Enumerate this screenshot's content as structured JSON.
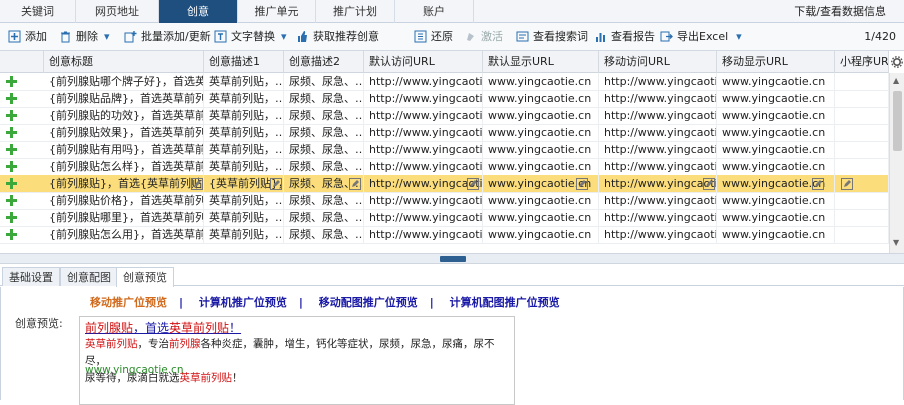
{
  "tabs": [
    "关键词",
    "网页地址",
    "创意",
    "推广单元",
    "推广计划",
    "账户"
  ],
  "tabbar_right": "下载/查看数据信息",
  "toolbar": {
    "add": "添加",
    "delete": "删除",
    "batch": "批量添加/更新",
    "replace": "文字替换",
    "fetch": "获取推荐创意",
    "restore": "还原",
    "activate": "激活",
    "search_word": "查看搜索词",
    "report": "查看报告",
    "export": "导出Excel",
    "pager": "1/420"
  },
  "columns": [
    "创意标题",
    "创意描述1",
    "创意描述2",
    "默认访问URL",
    "默认显示URL",
    "移动访问URL",
    "移动显示URL",
    "小程序URL"
  ],
  "rows": [
    {
      "title": "{前列腺贴哪个牌子好}，首选英草…",
      "d1": "英草前列贴，…",
      "d2": "尿频、尿急、…",
      "url": "http://www.yingcaotie.cn",
      "durl": "www.yingcaotie.cn",
      "murl": "http://www.yingcaotie.cn",
      "mdurl": "www.yingcaotie.cn"
    },
    {
      "title": "{前列腺贴品牌}，首选英草前列贴！",
      "d1": "英草前列贴，…",
      "d2": "尿频、尿急、…",
      "url": "http://www.yingcaotie.cn",
      "durl": "www.yingcaotie.cn",
      "murl": "http://www.yingcaotie.cn",
      "mdurl": "www.yingcaotie.cn"
    },
    {
      "title": "{前列腺贴的功效}，首选英草前列…",
      "d1": "英草前列贴，…",
      "d2": "尿频、尿急、…",
      "url": "http://www.yingcaotie.cn",
      "durl": "www.yingcaotie.cn",
      "murl": "http://www.yingcaotie.cn",
      "mdurl": "www.yingcaotie.cn"
    },
    {
      "title": "{前列腺贴效果}，首选英草前列贴！",
      "d1": "英草前列贴，…",
      "d2": "尿频、尿急、…",
      "url": "http://www.yingcaotie.cn",
      "durl": "www.yingcaotie.cn",
      "murl": "http://www.yingcaotie.cn",
      "mdurl": "www.yingcaotie.cn"
    },
    {
      "title": "{前列腺贴有用吗}，首选英草前列…",
      "d1": "英草前列贴，…",
      "d2": "尿频、尿急、…",
      "url": "http://www.yingcaotie.cn",
      "durl": "www.yingcaotie.cn",
      "murl": "http://www.yingcaotie.cn",
      "mdurl": "www.yingcaotie.cn"
    },
    {
      "title": "{前列腺贴怎么样}，首选英草前列…",
      "d1": "英草前列贴，…",
      "d2": "尿频、尿急、…",
      "url": "http://www.yingcaotie.cn",
      "durl": "www.yingcaotie.cn",
      "murl": "http://www.yingcaotie.cn",
      "mdurl": "www.yingcaotie.cn"
    },
    {
      "title": "{前列腺贴}，首选{英草前列贴}！",
      "d1": "{英草前列贴}，…",
      "d2": "尿频、尿急、…",
      "url": "http://www.yingcaotie.cn",
      "durl": "www.yingcaotie.cn",
      "murl": "http://www.yingcaotie.cn",
      "mdurl": "www.yingcaotie.cn"
    },
    {
      "title": "{前列腺贴价格}，首选英草前列贴！",
      "d1": "英草前列贴，…",
      "d2": "尿频、尿急、…",
      "url": "http://www.yingcaotie.cn",
      "durl": "www.yingcaotie.cn",
      "murl": "http://www.yingcaotie.cn",
      "mdurl": "www.yingcaotie.cn"
    },
    {
      "title": "{前列腺贴哪里}，首选英草前列贴！",
      "d1": "英草前列贴，…",
      "d2": "尿频、尿急、…",
      "url": "http://www.yingcaotie.cn",
      "durl": "www.yingcaotie.cn",
      "murl": "http://www.yingcaotie.cn",
      "mdurl": "www.yingcaotie.cn"
    },
    {
      "title": "{前列腺贴怎么用}，首选英草前列…",
      "d1": "英草前列贴，…",
      "d2": "尿频、尿急、…",
      "url": "http://www.yingcaotie.cn",
      "durl": "www.yingcaotie.cn",
      "murl": "http://www.yingcaotie.cn",
      "mdurl": "www.yingcaotie.cn"
    }
  ],
  "selected_row": 6,
  "panel_tabs": [
    "基础设置",
    "创意配图",
    "创意预览"
  ],
  "preview_links": [
    "移动推广位预览",
    "计算机推广位预览",
    "移动配图推广位预览",
    "计算机配图推广位预览"
  ],
  "preview_label": "创意预览:",
  "ad": {
    "title_a": "前列腺贴",
    "title_b": "，首选",
    "title_c": "英草前列贴",
    "title_d": "！",
    "desc1_a": "英草前列贴",
    "desc1_b": "，专治",
    "desc1_c": "前列腺",
    "desc1_d": "各种炎症，囊肿，增生，钙化等症状，尿频，尿急，尿痛，尿不尽，",
    "desc2_a": "尿等待，尿滴白就选",
    "desc2_b": "英草前列贴",
    "desc2_c": "！",
    "url": "www.yingcaotie.cn"
  },
  "colors": {
    "accent": "#1e4f7e",
    "selected_row": "#fbdd7c",
    "keyword_red": "#d01010",
    "link_blue": "#1a1aa6",
    "url_green": "#2a8a2a",
    "preview_active": "#d16a1c"
  }
}
